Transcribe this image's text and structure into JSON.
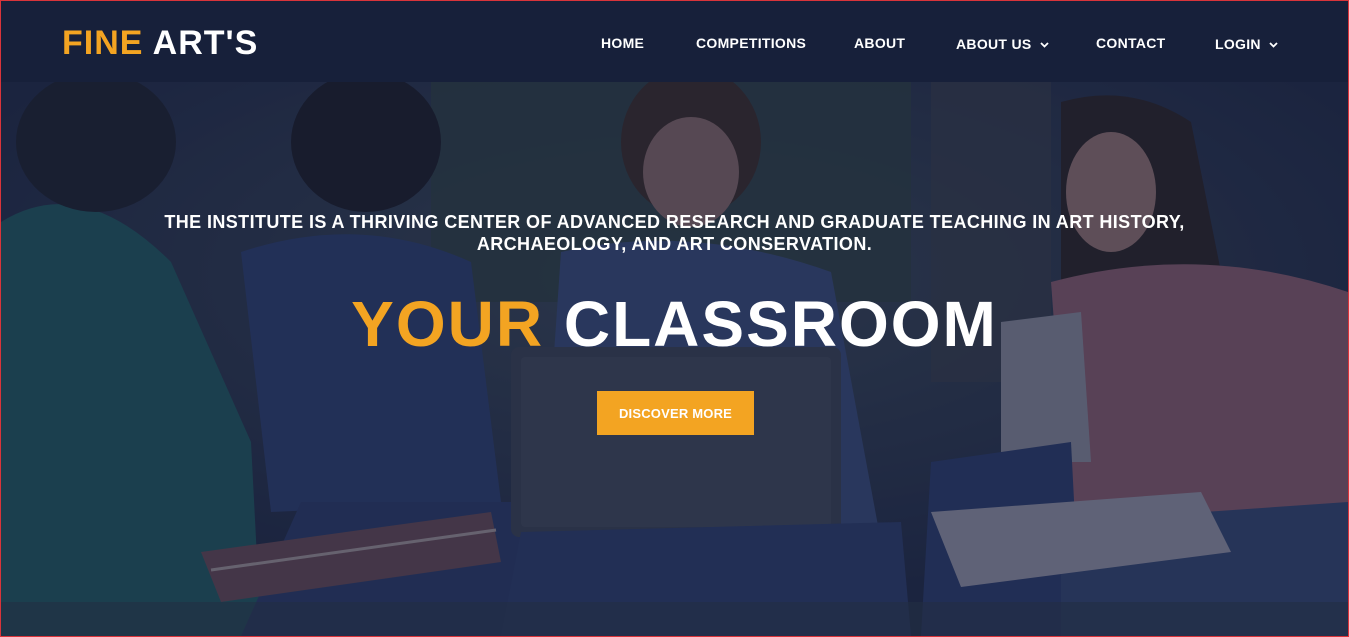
{
  "brand": {
    "logo_accent": "FINE",
    "logo_rest": "ART'S",
    "accent_color": "#f3a422",
    "navbar_color": "#17203a"
  },
  "nav": {
    "items": [
      {
        "label": "HOME"
      },
      {
        "label": "COMPETITIONS"
      },
      {
        "label": "ABOUT"
      },
      {
        "label": "ABOUT US",
        "icon": "chevron-down-icon"
      },
      {
        "label": "CONTACT"
      },
      {
        "label": "LOGIN",
        "icon": "chevron-down-icon"
      }
    ]
  },
  "hero": {
    "tagline_line1": "THE INSTITUTE IS A THRIVING CENTER OF ADVANCED RESEARCH AND GRADUATE TEACHING IN ART HISTORY,",
    "tagline_line2": "ARCHAEOLOGY, AND ART CONSERVATION.",
    "headline_accent": "YOUR",
    "headline_rest": "CLASSROOM",
    "cta_label": "DISCOVER MORE",
    "background": "students-studying-outdoors-photo"
  }
}
